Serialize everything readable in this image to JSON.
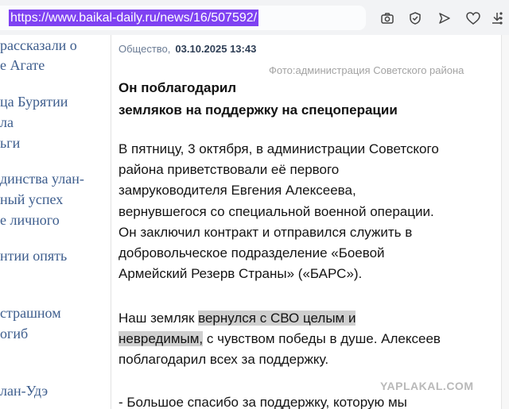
{
  "browser": {
    "url": "https://www.baikal-daily.ru/news/16/507592/",
    "toolbar_icons": [
      "camera-icon",
      "shield-check-icon",
      "send-icon",
      "heart-icon",
      "download-icon",
      "more-vert-icon"
    ]
  },
  "sidebar": {
    "lines": [
      "рассказали о",
      "е Агате",
      "ца Бурятии",
      "ла",
      "ьги",
      "динства улан-",
      "ный успех",
      "е личного",
      "нтии опять",
      "страшном",
      "огиб",
      "лан-Удэ"
    ]
  },
  "article": {
    "rubric": "Общество,",
    "date": "03.10.2025 13:43",
    "photo_credit": "Фото:администрация Советского района",
    "headline_lines": [
      "Он поблагодарил",
      "земляков на поддержку на спецоперации"
    ],
    "paragraph1": [
      "В пятницу, 3 октября, в администрации Советского",
      "района приветствовали её первого",
      "замруководителя Евгения Алексеева,",
      "вернувшегося со специальной военной операции.",
      "Он заключил контракт и отправился служить в",
      "добровольческое подразделение «Боевой",
      "Армейский Резерв Страны» («БАРС»)."
    ],
    "paragraph2": {
      "line1_pre": "Наш земляк ",
      "line1_hl": "вернулся с СВО целым и",
      "line2_hl": "невредимым,",
      "line2_post": " с чувством победы в душе. Алексеев",
      "line3": "поблагодарил всех за поддержку."
    },
    "paragraph3_line1": "- Большое спасибо за поддержку, которую мы"
  },
  "watermark": "YAPLAKAL.COM"
}
